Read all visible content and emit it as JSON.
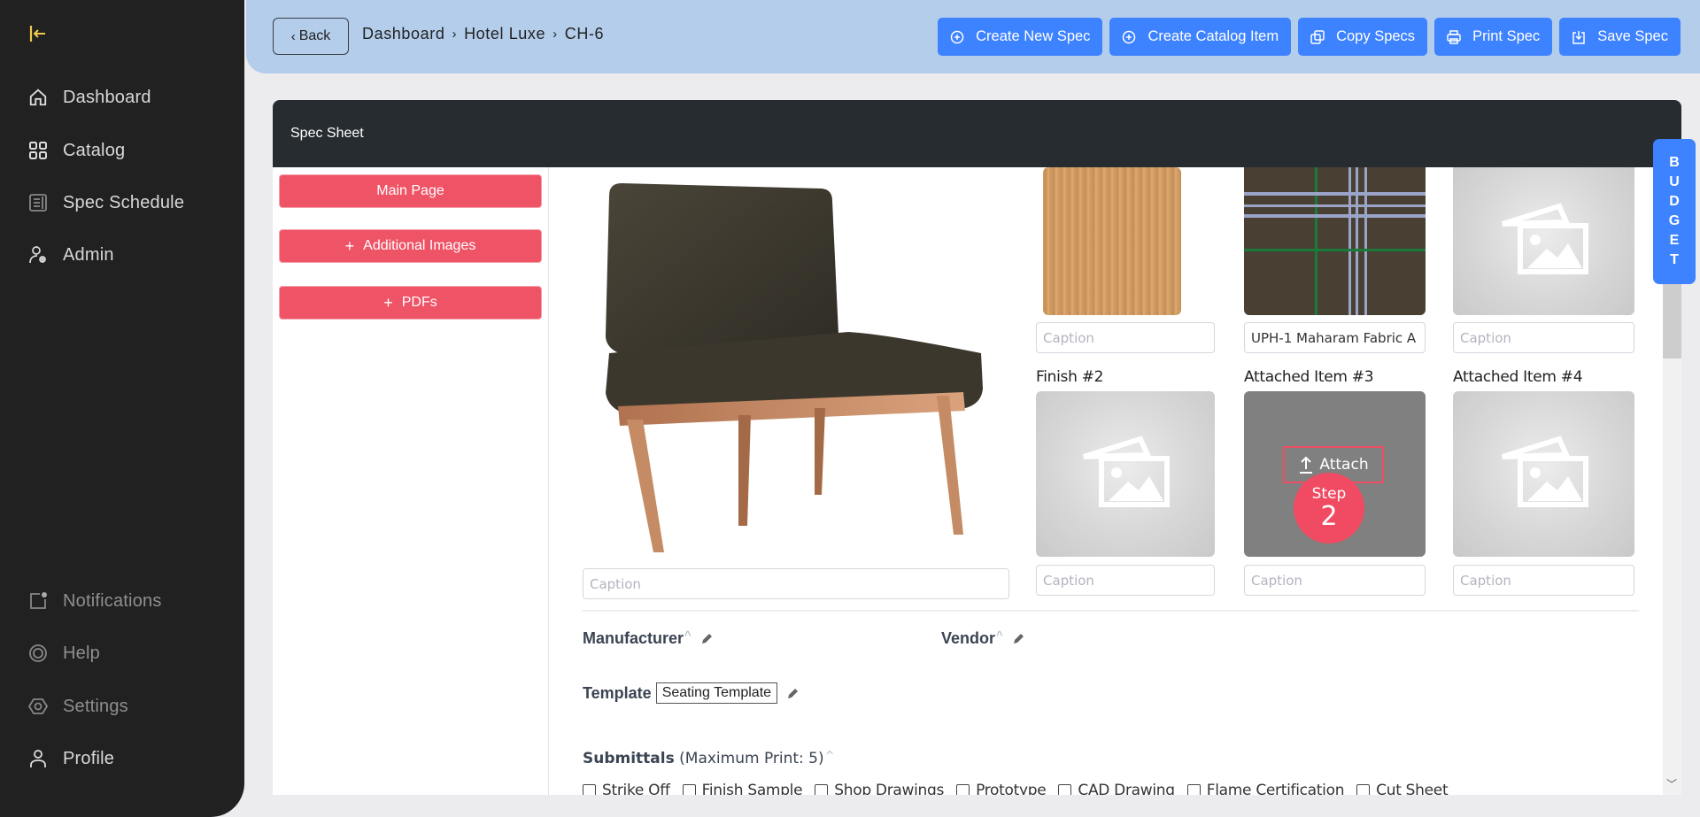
{
  "sidebar": {
    "top_items": [
      {
        "label": "Dashboard",
        "icon": "home-icon"
      },
      {
        "label": "Catalog",
        "icon": "grid-icon"
      },
      {
        "label": "Spec Schedule",
        "icon": "document-icon"
      },
      {
        "label": "Admin",
        "icon": "user-gear-icon"
      }
    ],
    "bottom_items": [
      {
        "label": "Notifications",
        "icon": "notification-icon"
      },
      {
        "label": "Help",
        "icon": "lifebuoy-icon"
      },
      {
        "label": "Settings",
        "icon": "settings-icon"
      },
      {
        "label": "Profile",
        "icon": "user-icon"
      }
    ]
  },
  "header": {
    "back_label": "Back",
    "breadcrumb": [
      "Dashboard",
      "Hotel Luxe",
      "CH-6"
    ],
    "actions": [
      {
        "label": "Create New Spec",
        "icon": "plus-circle-icon"
      },
      {
        "label": "Create Catalog Item",
        "icon": "plus-circle-icon"
      },
      {
        "label": "Copy Specs",
        "icon": "copy-icon"
      },
      {
        "label": "Print Spec",
        "icon": "printer-icon"
      },
      {
        "label": "Save Spec",
        "icon": "save-icon"
      }
    ]
  },
  "card": {
    "title": "Spec Sheet",
    "left_buttons": [
      {
        "label": "Main Page",
        "plus": false
      },
      {
        "label": "Additional Images",
        "plus": true
      },
      {
        "label": "PDFs",
        "plus": true
      }
    ]
  },
  "images": {
    "caption_placeholder": "Caption",
    "main_caption": "",
    "top_row": [
      {
        "type": "wood",
        "caption": ""
      },
      {
        "type": "plaid",
        "caption": "UPH-1 Maharam Fabric A"
      },
      {
        "type": "placeholder",
        "caption": ""
      }
    ],
    "second_row": [
      {
        "label": "Finish #2",
        "type": "placeholder",
        "caption": ""
      },
      {
        "label": "Attached Item #3",
        "type": "attach",
        "caption": ""
      },
      {
        "label": "Attached Item #4",
        "type": "placeholder",
        "caption": ""
      }
    ],
    "attach_label": "Attach",
    "step_label": "Step",
    "step_number": "2"
  },
  "fields": {
    "manufacturer_label": "Manufacturer",
    "vendor_label": "Vendor",
    "template_label": "Template",
    "template_value": "Seating Template",
    "submittals_label": "Submittals",
    "submittals_note": "(Maximum Print: 5)",
    "submittal_options": [
      "Strike Off",
      "Finish Sample",
      "Shop Drawings",
      "Prototype",
      "CAD Drawing",
      "Flame Certification",
      "Cut Sheet"
    ]
  },
  "budget_tab": [
    "B",
    "U",
    "D",
    "G",
    "E",
    "T"
  ],
  "colors": {
    "accent_blue": "#3d82ff",
    "header_bg": "#b3cdeb",
    "pink": "#ee5366",
    "sidebar_bg": "#212121",
    "logo_yellow": "#f2c94c"
  }
}
